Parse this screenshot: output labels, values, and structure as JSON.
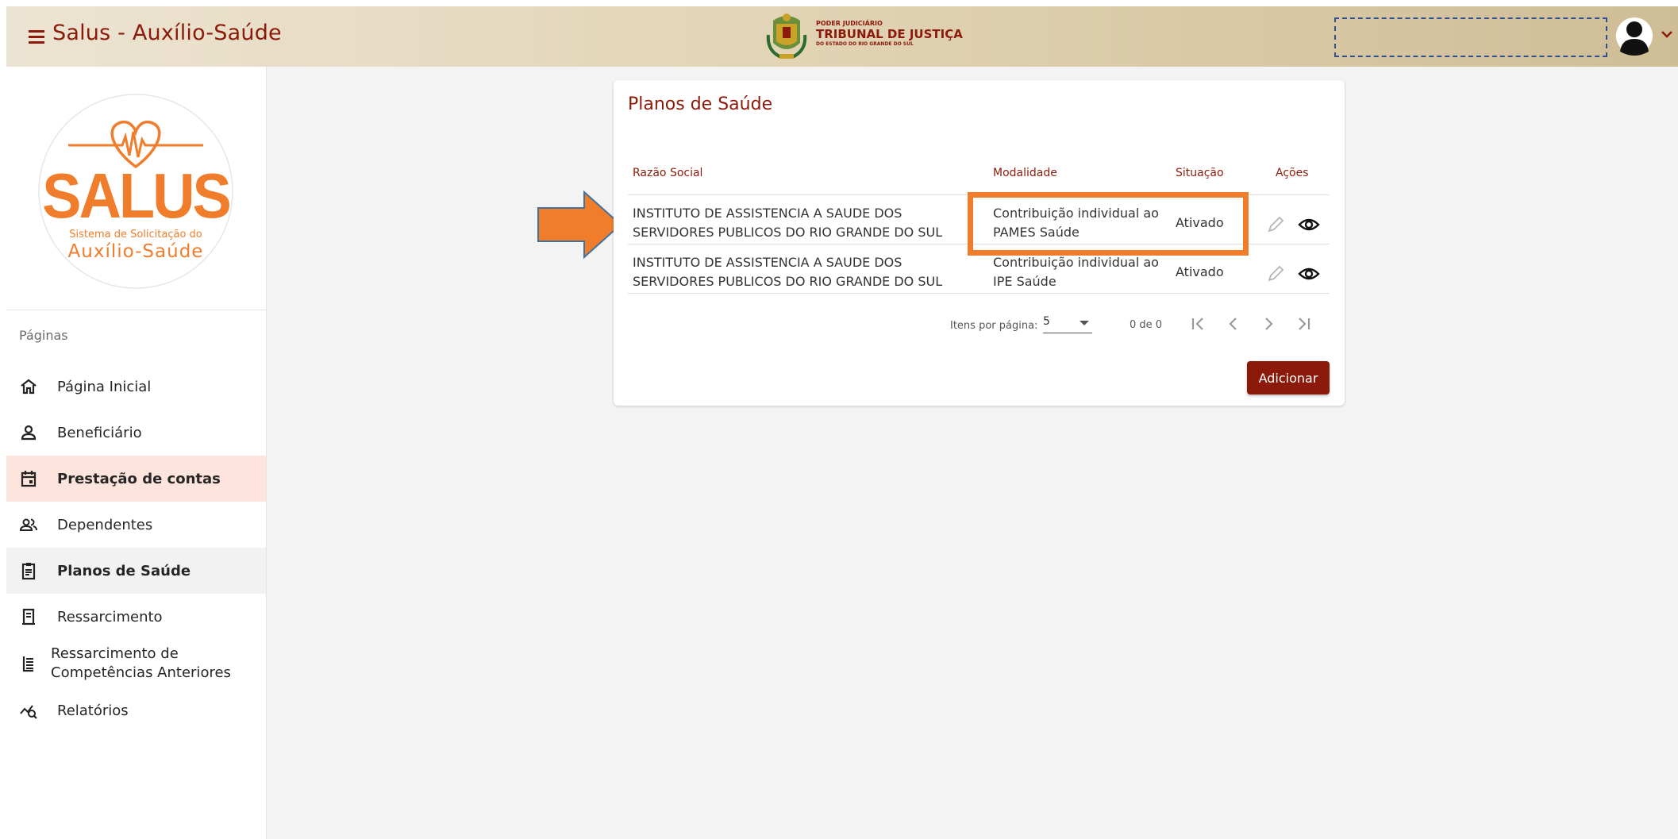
{
  "header": {
    "title": "Salus - Auxílio-Saúde",
    "court_line1": "PODER JUDICIÁRIO",
    "court_line2": "TRIBUNAL DE JUSTIÇA",
    "court_line3": "DO ESTADO DO RIO GRANDE DO SUL"
  },
  "logo": {
    "name": "SALUS",
    "subtitle": "Sistema de Solicitação do",
    "tagline": "Auxílio-Saúde"
  },
  "sidebar": {
    "section_label": "Páginas",
    "items": [
      {
        "label": "Página Inicial",
        "icon": "home-icon"
      },
      {
        "label": "Beneficiário",
        "icon": "person-icon"
      },
      {
        "label": "Prestação de contas",
        "icon": "calendar-icon"
      },
      {
        "label": "Dependentes",
        "icon": "people-icon"
      },
      {
        "label": "Planos de Saúde",
        "icon": "clipboard-icon"
      },
      {
        "label": "Ressarcimento",
        "icon": "receipt-icon"
      },
      {
        "label": "Ressarcimento de Competências Anteriores",
        "icon": "list-icon"
      },
      {
        "label": "Relatórios",
        "icon": "analytics-icon"
      }
    ]
  },
  "card": {
    "title": "Planos de Saúde",
    "columns": [
      "Razão Social",
      "Modalidade",
      "Situação",
      "Ações"
    ],
    "rows": [
      {
        "razao_social": "INSTITUTO DE ASSISTENCIA A SAUDE DOS SERVIDORES PUBLICOS DO RIO GRANDE DO SUL",
        "modalidade": "Contribuição individual ao PAMES Saúde",
        "situacao": "Ativado"
      },
      {
        "razao_social": "INSTITUTO DE ASSISTENCIA A SAUDE DOS SERVIDORES PUBLICOS DO RIO GRANDE DO SUL",
        "modalidade": "Contribuição individual ao IPE Saúde",
        "situacao": "Ativado"
      }
    ],
    "paginator": {
      "items_per_page_label": "Itens por página:",
      "page_size": "5",
      "range_label": "0 de 0"
    },
    "add_button": "Adicionar"
  },
  "annotation_colors": {
    "highlight": "#ef7d2b",
    "accent": "#8b1a0a"
  }
}
